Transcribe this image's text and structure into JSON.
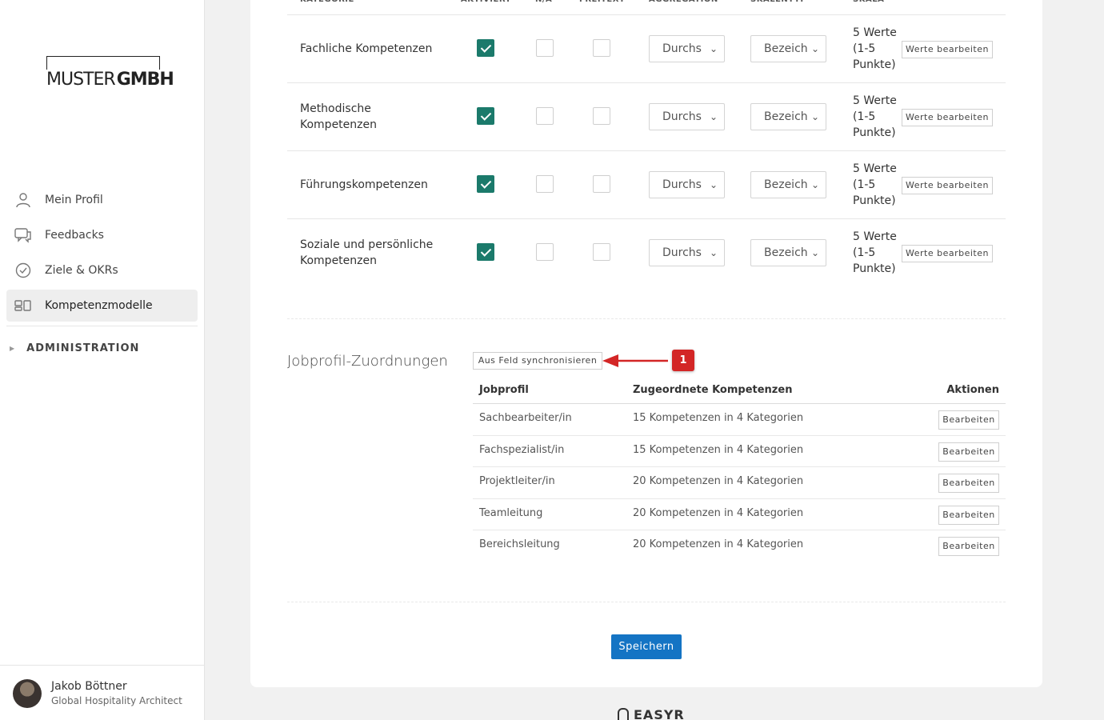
{
  "logo": {
    "left": "MUSTER",
    "right": "GMBH"
  },
  "nav": {
    "items": [
      {
        "label": "Mein Profil",
        "icon": "person-icon"
      },
      {
        "label": "Feedbacks",
        "icon": "chat-icon"
      },
      {
        "label": "Ziele & OKRs",
        "icon": "check-circle-icon"
      },
      {
        "label": "Kompetenzmodelle",
        "icon": "model-icon",
        "active": true
      }
    ],
    "admin": "ADMINISTRATION"
  },
  "user": {
    "name": "Jakob Böttner",
    "role": "Global Hospitality Architect"
  },
  "categories": {
    "headers": [
      "KATEGORIE",
      "AKTIVIERT",
      "N/A",
      "FREITEXT",
      "AGGREGATION",
      "SKALENTYP",
      "SKALA"
    ],
    "rows": [
      {
        "name": "Fachliche Kompetenzen",
        "aktiviert": true,
        "na": false,
        "freitext": false,
        "aggregation": "Durchs",
        "skalentyp": "Bezeich",
        "skala": "5 Werte (1-5 Punkte)",
        "button": "Werte bearbeiten"
      },
      {
        "name": "Methodische Kompetenzen",
        "aktiviert": true,
        "na": false,
        "freitext": false,
        "aggregation": "Durchs",
        "skalentyp": "Bezeich",
        "skala": "5 Werte (1-5 Punkte)",
        "button": "Werte bearbeiten"
      },
      {
        "name": "Führungskompetenzen",
        "aktiviert": true,
        "na": false,
        "freitext": false,
        "aggregation": "Durchs",
        "skalentyp": "Bezeich",
        "skala": "5 Werte (1-5 Punkte)",
        "button": "Werte bearbeiten"
      },
      {
        "name": "Soziale und persönliche Kompetenzen",
        "aktiviert": true,
        "na": false,
        "freitext": false,
        "aggregation": "Durchs",
        "skalentyp": "Bezeich",
        "skala": "5 Werte (1-5 Punkte)",
        "button": "Werte bearbeiten"
      }
    ]
  },
  "jobprofile": {
    "title": "Jobprofil-Zuordnungen",
    "sync_button": "Aus Feld synchronisieren",
    "badge": "1",
    "columns": [
      "Jobprofil",
      "Zugeordnete Kompetenzen",
      "Aktionen"
    ],
    "rows": [
      {
        "profil": "Sachbearbeiter/in",
        "kompetenzen": "15 Kompetenzen in 4 Kategorien",
        "action": "Bearbeiten"
      },
      {
        "profil": "Fachspezialist/in",
        "kompetenzen": "15 Kompetenzen in 4 Kategorien",
        "action": "Bearbeiten"
      },
      {
        "profil": "Projektleiter/in",
        "kompetenzen": "20 Kompetenzen in 4 Kategorien",
        "action": "Bearbeiten"
      },
      {
        "profil": "Teamleitung",
        "kompetenzen": "20 Kompetenzen in 4 Kategorien",
        "action": "Bearbeiten"
      },
      {
        "profil": "Bereichsleitung",
        "kompetenzen": "20 Kompetenzen in 4 Kategorien",
        "action": "Bearbeiten"
      }
    ]
  },
  "save_label": "Speichern",
  "footer_brand": "EASYR",
  "colors": {
    "check": "#1b7a6b",
    "primary": "#1474c4",
    "badge": "#d32626"
  }
}
